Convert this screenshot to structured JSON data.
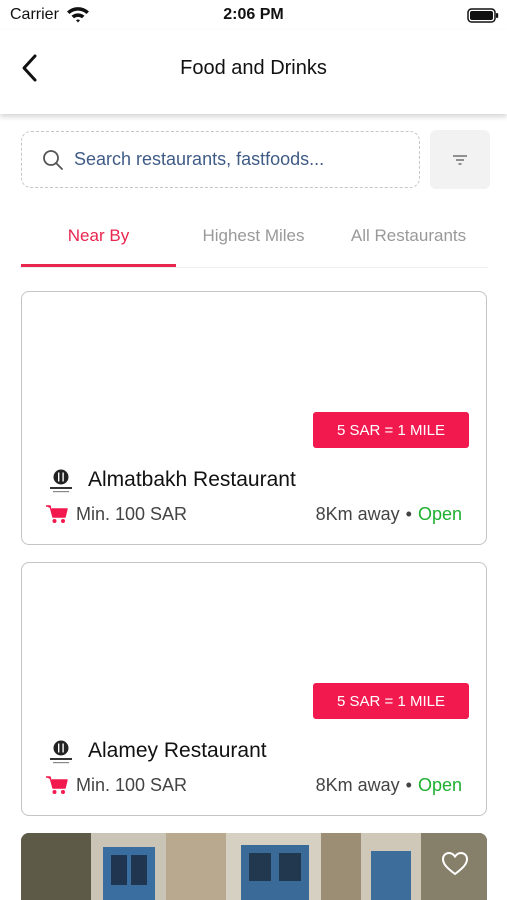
{
  "status_bar": {
    "carrier": "Carrier",
    "time": "2:06 PM"
  },
  "header": {
    "title": "Food and Drinks"
  },
  "search": {
    "placeholder": "Search restaurants, fastfoods..."
  },
  "tabs": [
    {
      "label": "Near By",
      "active": true
    },
    {
      "label": "Highest Miles",
      "active": false
    },
    {
      "label": "All Restaurants",
      "active": false
    }
  ],
  "restaurants": [
    {
      "promo": "5 SAR = 1 MILE",
      "name": "Almatbakh Restaurant",
      "min_order": "Min. 100 SAR",
      "distance": "8Km away",
      "separator": "•",
      "status": "Open"
    },
    {
      "promo": "5 SAR = 1 MILE",
      "name": "Alamey Restaurant",
      "min_order": "Min. 100 SAR",
      "distance": "8Km away",
      "separator": "•",
      "status": "Open"
    }
  ],
  "icons": [
    "wifi-icon",
    "battery-icon",
    "back-arrow-icon",
    "search-icon",
    "filter-icon",
    "restaurant-logo-icon",
    "cart-icon",
    "heart-icon"
  ],
  "colors": {
    "accent": "#f2194f",
    "tab_active": "#e8264e",
    "open": "#1db02f",
    "placeholder": "#3f5b86"
  }
}
